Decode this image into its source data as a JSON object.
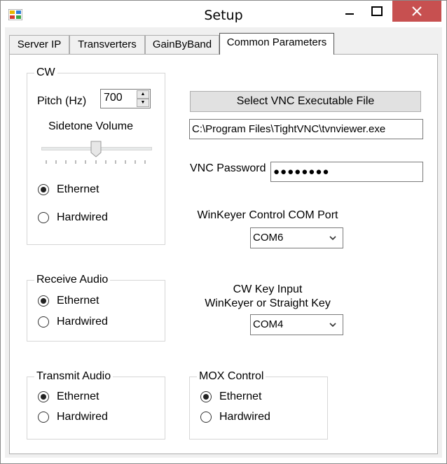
{
  "window": {
    "title": "Setup",
    "accent_close": "#c75050"
  },
  "tabs": [
    {
      "label": "Server IP"
    },
    {
      "label": "Transverters"
    },
    {
      "label": "GainByBand"
    },
    {
      "label": "Common Parameters"
    }
  ],
  "cw": {
    "title": "CW",
    "pitch_label": "Pitch (Hz)",
    "pitch_value": "700",
    "sidetone_label": "Sidetone Volume",
    "sidetone_level": 0.5,
    "options": [
      {
        "label": "Ethernet",
        "checked": true
      },
      {
        "label": "Hardwired",
        "checked": false
      }
    ]
  },
  "receive_audio": {
    "title": "Receive Audio",
    "options": [
      {
        "label": "Ethernet",
        "checked": true
      },
      {
        "label": "Hardwired",
        "checked": false
      }
    ]
  },
  "transmit_audio": {
    "title": "Transmit Audio",
    "options": [
      {
        "label": "Ethernet",
        "checked": true
      },
      {
        "label": "Hardwired",
        "checked": false
      }
    ]
  },
  "mox_control": {
    "title": "MOX Control",
    "options": [
      {
        "label": "Ethernet",
        "checked": true
      },
      {
        "label": "Hardwired",
        "checked": false
      }
    ]
  },
  "vnc": {
    "select_button": "Select VNC Executable File",
    "path_value": "C:\\Program Files\\TightVNC\\tvnviewer.exe",
    "password_label": "VNC Password",
    "password_value": "●●●●●●●●"
  },
  "winkeyer": {
    "label": "WinKeyer Control COM Port",
    "selected": "COM6"
  },
  "cw_key": {
    "label_line1": "CW Key Input",
    "label_line2": "WinKeyer or Straight Key",
    "selected": "COM4"
  }
}
